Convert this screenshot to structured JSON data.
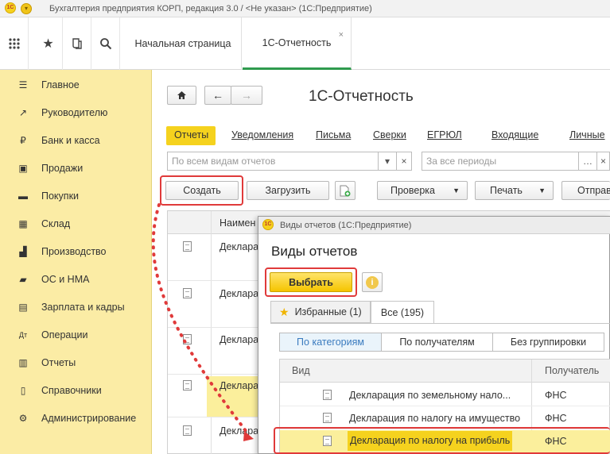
{
  "window_title": "Бухгалтерия предприятия КОРП, редакция 3.0 / <Не указан>  (1С:Предприятие)",
  "logo_text": "1С",
  "tabs": [
    {
      "label": "Начальная страница"
    },
    {
      "label": "1С-Отчетность",
      "close": "×"
    }
  ],
  "sidebar": {
    "items": [
      {
        "label": "Главное",
        "icon": "menu-icon"
      },
      {
        "label": "Руководителю",
        "icon": "trend-icon"
      },
      {
        "label": "Банк и касса",
        "icon": "coin-icon"
      },
      {
        "label": "Продажи",
        "icon": "bag-icon"
      },
      {
        "label": "Покупки",
        "icon": "cart-icon"
      },
      {
        "label": "Склад",
        "icon": "warehouse-icon"
      },
      {
        "label": "Производство",
        "icon": "factory-icon"
      },
      {
        "label": "ОС и НМА",
        "icon": "truck-icon"
      },
      {
        "label": "Зарплата и кадры",
        "icon": "people-icon"
      },
      {
        "label": "Операции",
        "icon": "ops-icon"
      },
      {
        "label": "Отчеты",
        "icon": "chart-icon"
      },
      {
        "label": "Справочники",
        "icon": "book-icon"
      },
      {
        "label": "Администрирование",
        "icon": "gear-icon"
      }
    ]
  },
  "page": {
    "title": "1С-Отчетность",
    "sections": [
      "Отчеты",
      "Уведомления",
      "Письма",
      "Сверки",
      "ЕГРЮЛ",
      "Входящие",
      "Личные"
    ],
    "filter_kind_placeholder": "По всем видам отчетов",
    "filter_period_placeholder": "За все периоды",
    "toolbar": {
      "create": "Создать",
      "load": "Загрузить",
      "check": "Проверка",
      "print": "Печать",
      "send": "Отправ"
    },
    "column_name": "Наимен",
    "rows": [
      "Деклара",
      "Деклара",
      "Деклара",
      "Деклара",
      "Деклара"
    ]
  },
  "dialog": {
    "window_title": "Виды отчетов  (1С:Предприятие)",
    "heading": "Виды отчетов",
    "select_button": "Выбрать",
    "tabs": [
      "Избранные (1)",
      "Все (195)"
    ],
    "grouping": [
      "По категориям",
      "По получателям",
      "Без группировки"
    ],
    "columns": {
      "kind": "Вид",
      "recipient": "Получатель"
    },
    "rows": [
      {
        "name": "Декларация по земельному нало...",
        "recipient": "ФНС"
      },
      {
        "name": "Декларация по налогу на имущество",
        "recipient": "ФНС"
      },
      {
        "name": "Декларация по налогу на прибыль",
        "recipient": "ФНС"
      }
    ]
  },
  "colors": {
    "sidebar": "#fbeca5",
    "accent_yellow": "#f5d21e",
    "highlight_red": "#e03a3a",
    "tab_active_green": "#2f9b4e"
  }
}
